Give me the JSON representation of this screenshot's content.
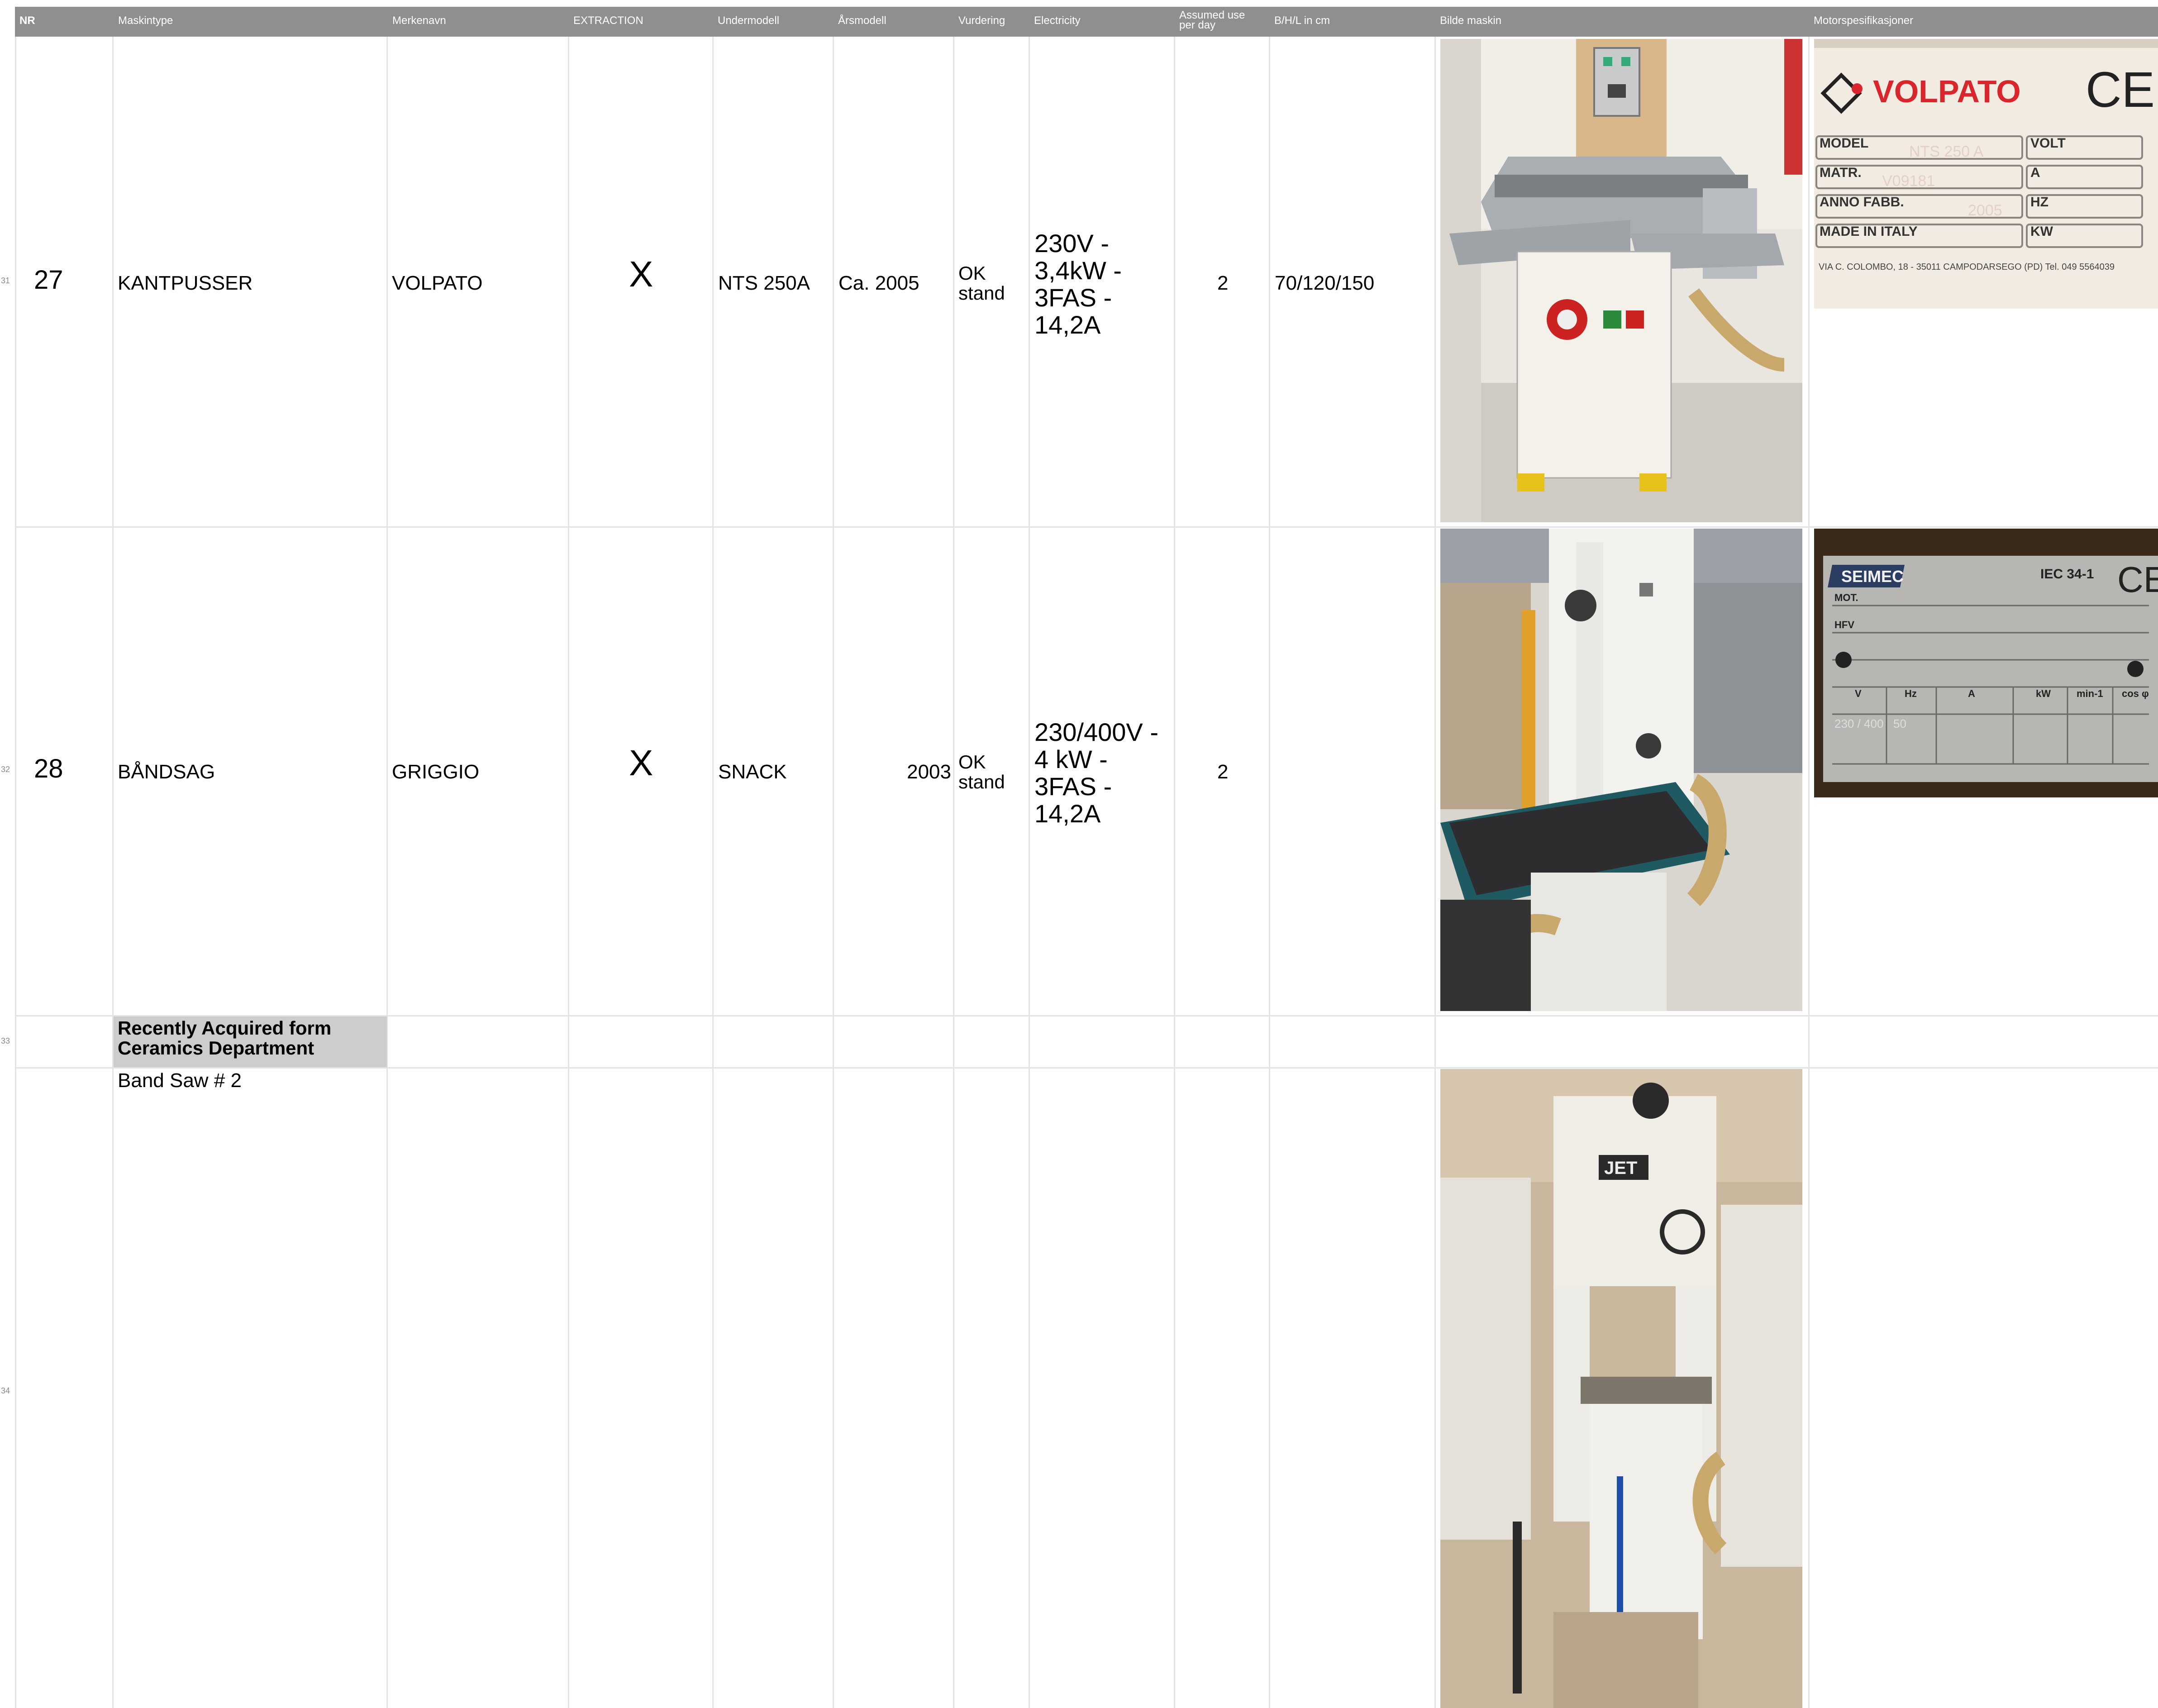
{
  "headers": {
    "nr": "NR",
    "maskintype": "Maskintype",
    "merkenavn": "Merkenavn",
    "extraction": "EXTRACTION",
    "undermodell": "Undermodell",
    "arsmodell": "Årsmodell",
    "vurdering": "Vurdering",
    "electricity": "Electricity",
    "assumed_use_line1": "Assumed use",
    "assumed_use_line2": "per day",
    "bhl": "B/H/L in cm",
    "bilde": "Bilde maskin",
    "motorspes": "Motorspesifikasjoner"
  },
  "row_numbers": [
    "31",
    "32",
    "33",
    "34"
  ],
  "rows": [
    {
      "nr": "27",
      "maskintype": "KANTPUSSER",
      "merkenavn": "VOLPATO",
      "extraction": "X",
      "undermodell": "NTS 250A",
      "arsmodell": "Ca. 2005",
      "vurdering_l1": "OK",
      "vurdering_l2": "stand",
      "electricity": [
        "230V -",
        "3,4kW -",
        "3FAS -",
        "14,2A"
      ],
      "assumed_use": "2",
      "bhl": "70/120/150",
      "plate": {
        "brand": "VOLPATO",
        "ce": "CE",
        "labels": [
          "MODEL",
          "MATR.",
          "ANNO FABB.",
          "MADE IN ITALY"
        ],
        "right_labels": [
          "VOLT",
          "A",
          "HZ",
          "KW"
        ],
        "values": [
          "NTS 250 A",
          "V09181",
          "2005"
        ],
        "address": "VIA C. COLOMBO, 18 - 35011 CAMPODARSEGO (PD) Tel. 049 5564039"
      }
    },
    {
      "nr": "28",
      "maskintype": "BÅNDSAG",
      "merkenavn": "GRIGGIO",
      "extraction": "X",
      "undermodell": "SNACK",
      "arsmodell": "2003",
      "vurdering_l1": "OK",
      "vurdering_l2": "stand",
      "electricity": [
        "230/400V -",
        "4 kW -",
        "3FAS -",
        "14,2A"
      ],
      "assumed_use": "2",
      "bhl": "",
      "plate": {
        "brand": "SEIMEC",
        "standard": "IEC 34-1",
        "ce": "CE",
        "labels": [
          "MOT.",
          "HFV",
          "V",
          "Hz",
          "A",
          "kW",
          "min-1",
          "cos φ"
        ],
        "values": [
          "230 / 400",
          "50"
        ]
      }
    }
  ],
  "section_note_line1": "Recently Acquired form",
  "section_note_line2": "Ceramics Department",
  "row34_label": "Band Saw # 2",
  "photo3_brand": "JET",
  "colors": {
    "header_bg": "#8f8f8f",
    "grid": "#e3e3e3",
    "note_bg": "#cdcdcd",
    "volpato_red": "#d8262c"
  }
}
